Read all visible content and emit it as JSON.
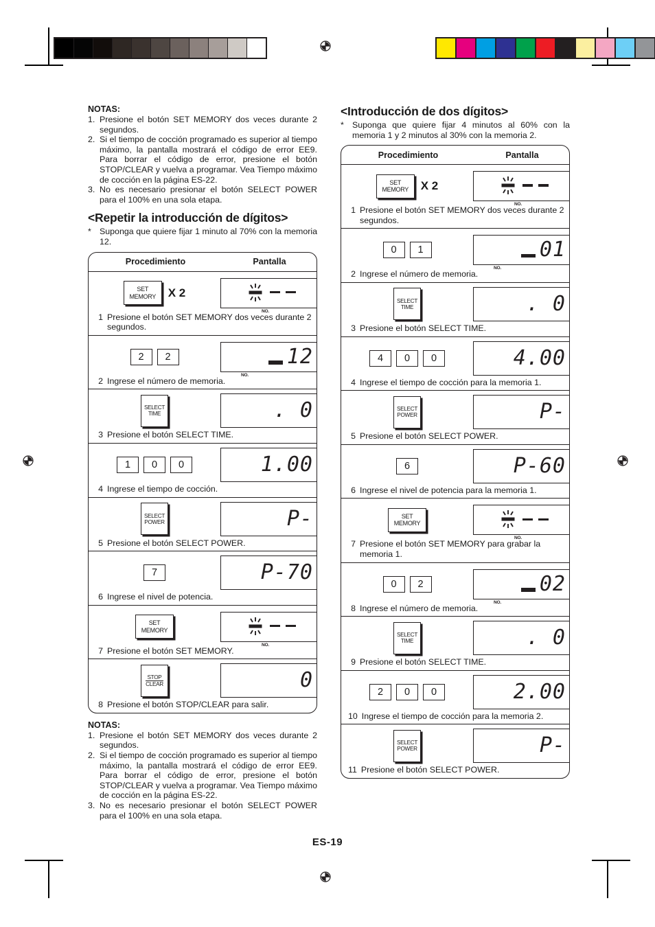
{
  "page": {
    "number": "ES-19"
  },
  "print_marks": {
    "grayscale_bar": [
      "#000000",
      "#050505",
      "#120d0b",
      "#2e2723",
      "#3a322e",
      "#4e4642",
      "#6b615d",
      "#8c817d",
      "#a79e9a",
      "#cfcac5",
      "#ffffff"
    ],
    "color_bar": [
      "#ffe800",
      "#e6007e",
      "#009fe3",
      "#2e3192",
      "#00a14b",
      "#ed1c24",
      "#231f20",
      "#fbefa0",
      "#f4a7c3",
      "#6dcff6",
      "#939598"
    ],
    "registration_icon": "registration-target-icon"
  },
  "left_column": {
    "notes_top": {
      "title": "NOTAS:",
      "items": [
        {
          "n": "1.",
          "text": "Presione el botón SET MEMORY dos veces durante 2 segundos."
        },
        {
          "n": "2.",
          "text": "Si el tiempo de cocción programado es superior al tiempo máximo, la pantalla mostrará el código de error EE9. Para borrar el código de error, presione el botón STOP/CLEAR y vuelva a programar. Vea Tiempo máximo de cocción en la página ES-22."
        },
        {
          "n": "3.",
          "text": "No es necesario presionar el botón SELECT POWER para el 100% en una sola etapa."
        }
      ]
    },
    "heading": "<Repetir la introducción de dígitos>",
    "assumption": "Suponga que quiere fijar 1 minuto al 70% con la memoria 12.",
    "table": {
      "header": {
        "procedure": "Procedimiento",
        "display": "Pantalla"
      },
      "rows": [
        {
          "num": "1",
          "caption": "Presione el botón SET MEMORY dos veces durante 2 segundos.",
          "control": {
            "kind": "key",
            "style": "kmem",
            "lines": [
              "SET",
              "MEMORY"
            ],
            "multiplier": "X 2"
          },
          "display": {
            "kind": "memory-blank",
            "dashes": 2,
            "blinking": true,
            "label": "NO."
          }
        },
        {
          "num": "2",
          "caption": "Ingrese el número de memoria.",
          "control": {
            "kind": "numkeys",
            "keys": [
              "2",
              "2"
            ]
          },
          "display": {
            "kind": "memory-number",
            "value": "12",
            "label": "NO."
          }
        },
        {
          "num": "3",
          "caption": "Presione el botón SELECT TIME.",
          "control": {
            "kind": "key",
            "style": "ksel",
            "lines": [
              "SELECT",
              "TIME"
            ]
          },
          "display": {
            "kind": "seg",
            "value": ".  0"
          }
        },
        {
          "num": "4",
          "caption": "Ingrese el tiempo de cocción.",
          "control": {
            "kind": "numkeys",
            "keys": [
              "1",
              "0",
              "0"
            ]
          },
          "display": {
            "kind": "seg",
            "value": "1.00"
          }
        },
        {
          "num": "5",
          "caption": "Presione el botón SELECT POWER.",
          "control": {
            "kind": "key",
            "style": "ksel",
            "lines": [
              "SELECT",
              "POWER"
            ]
          },
          "display": {
            "kind": "seg",
            "value": "P-"
          }
        },
        {
          "num": "6",
          "caption": "Ingrese el nivel de potencia.",
          "control": {
            "kind": "numkeys",
            "keys": [
              "7"
            ]
          },
          "display": {
            "kind": "seg",
            "value": "P-70"
          }
        },
        {
          "num": "7",
          "caption": "Presione el botón SET MEMORY.",
          "control": {
            "kind": "key",
            "style": "kmem",
            "lines": [
              "SET",
              "MEMORY"
            ]
          },
          "display": {
            "kind": "memory-blank",
            "dashes": 2,
            "blinking": true,
            "label": "NO."
          }
        },
        {
          "num": "8",
          "caption": "Presione el botón STOP/CLEAR para salir.",
          "control": {
            "kind": "key",
            "style": "kstop",
            "lines": [
              "STOP",
              "CLEAR"
            ]
          },
          "display": {
            "kind": "seg",
            "value": "0"
          }
        }
      ]
    },
    "notes_bottom": {
      "title": "NOTAS:",
      "items": [
        {
          "n": "1.",
          "text": "Presione el botón SET MEMORY dos veces durante 2 segundos."
        },
        {
          "n": "2.",
          "text": "Si el tiempo de cocción programado es superior al tiempo máximo, la pantalla mostrará el código de error EE9. Para borrar el código de error, presione el botón STOP/CLEAR y vuelva a programar. Vea Tiempo máximo de cocción en la página ES-22."
        },
        {
          "n": "3.",
          "text": "No es necesario presionar el botón SELECT POWER para el 100% en una sola etapa."
        }
      ]
    }
  },
  "right_column": {
    "heading": "<Introducción de dos dígitos>",
    "assumption": "Suponga que quiere fijar 4 minutos al 60% con la memoria 1 y 2 minutos al 30% con la memoria 2.",
    "table": {
      "header": {
        "procedure": "Procedimiento",
        "display": "Pantalla"
      },
      "rows": [
        {
          "num": "1",
          "caption": "Presione el botón SET MEMORY dos veces durante 2 segundos.",
          "control": {
            "kind": "key",
            "style": "kmem",
            "lines": [
              "SET",
              "MEMORY"
            ],
            "multiplier": "X 2"
          },
          "display": {
            "kind": "memory-blank",
            "dashes": 2,
            "blinking": true,
            "label": "NO."
          }
        },
        {
          "num": "2",
          "caption": "Ingrese el número de memoria.",
          "control": {
            "kind": "numkeys",
            "keys": [
              "0",
              "1"
            ]
          },
          "display": {
            "kind": "memory-number",
            "value": "01",
            "label": "NO."
          }
        },
        {
          "num": "3",
          "caption": "Presione el botón SELECT TIME.",
          "control": {
            "kind": "key",
            "style": "ksel",
            "lines": [
              "SELECT",
              "TIME"
            ]
          },
          "display": {
            "kind": "seg",
            "value": ".  0"
          }
        },
        {
          "num": "4",
          "caption": "Ingrese el tiempo de cocción para la memoria 1.",
          "control": {
            "kind": "numkeys",
            "keys": [
              "4",
              "0",
              "0"
            ]
          },
          "display": {
            "kind": "seg",
            "value": "4.00"
          }
        },
        {
          "num": "5",
          "caption": "Presione el botón SELECT POWER.",
          "control": {
            "kind": "key",
            "style": "ksel",
            "lines": [
              "SELECT",
              "POWER"
            ]
          },
          "display": {
            "kind": "seg",
            "value": "P-"
          }
        },
        {
          "num": "6",
          "caption": "Ingrese el nivel de potencia para la memoria 1.",
          "control": {
            "kind": "numkeys",
            "keys": [
              "6"
            ]
          },
          "display": {
            "kind": "seg",
            "value": "P-60"
          }
        },
        {
          "num": "7",
          "caption": "Presione el botón SET MEMORY para grabar la memoria 1.",
          "control": {
            "kind": "key",
            "style": "kmem",
            "lines": [
              "SET",
              "MEMORY"
            ]
          },
          "display": {
            "kind": "memory-blank",
            "dashes": 2,
            "blinking": true,
            "label": "NO."
          }
        },
        {
          "num": "8",
          "caption": "Ingrese el número de memoria.",
          "control": {
            "kind": "numkeys",
            "keys": [
              "0",
              "2"
            ]
          },
          "display": {
            "kind": "memory-number",
            "value": "02",
            "label": "NO."
          }
        },
        {
          "num": "9",
          "caption": "Presione el botón SELECT TIME.",
          "control": {
            "kind": "key",
            "style": "ksel",
            "lines": [
              "SELECT",
              "TIME"
            ]
          },
          "display": {
            "kind": "seg",
            "value": ".  0"
          }
        },
        {
          "num": "10",
          "caption": "Ingrese el tiempo de cocción para la memoria 2.",
          "control": {
            "kind": "numkeys",
            "keys": [
              "2",
              "0",
              "0"
            ]
          },
          "display": {
            "kind": "seg",
            "value": "2.00"
          }
        },
        {
          "num": "11",
          "caption": "Presione el botón SELECT POWER.",
          "control": {
            "kind": "key",
            "style": "ksel",
            "lines": [
              "SELECT",
              "POWER"
            ]
          },
          "display": {
            "kind": "seg",
            "value": "P-"
          }
        }
      ]
    }
  }
}
